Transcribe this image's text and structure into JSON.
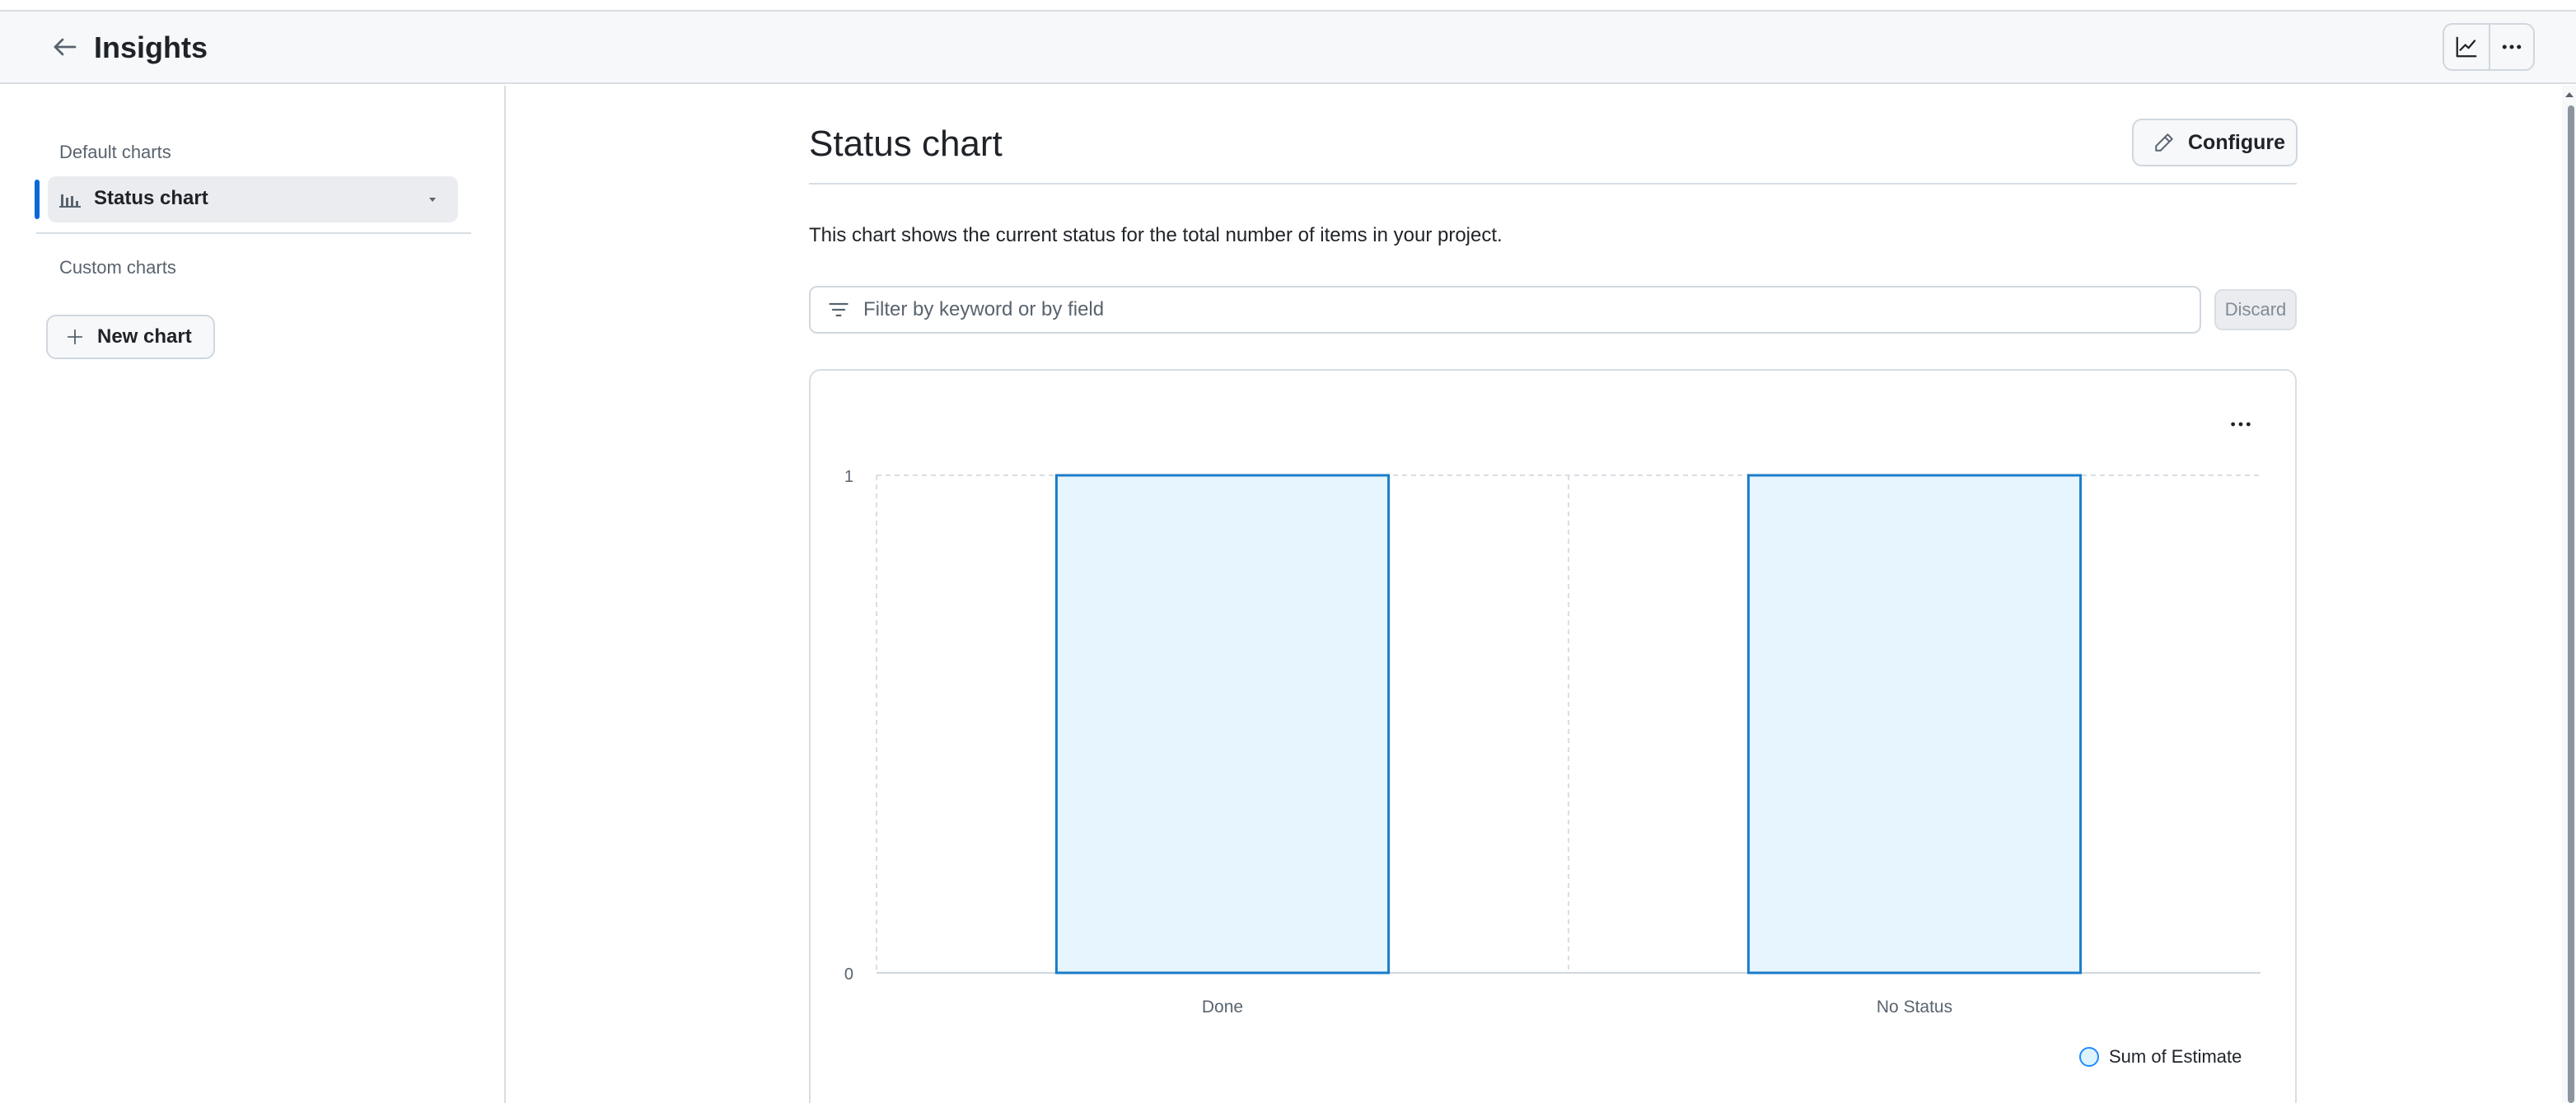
{
  "header": {
    "title": "Insights",
    "back_icon": "arrow-left-icon",
    "actions": [
      {
        "name": "insights-chart-icon"
      },
      {
        "name": "kebab-horizontal-icon"
      }
    ]
  },
  "sidebar": {
    "default_heading": "Default charts",
    "default_items": [
      {
        "label": "Status chart",
        "icon": "bar-chart-icon",
        "selected": true
      }
    ],
    "custom_heading": "Custom charts",
    "new_chart_label": "New chart"
  },
  "main": {
    "title": "Status chart",
    "configure_label": "Configure",
    "description": "This chart shows the current status for the total number of items in your project.",
    "filter": {
      "placeholder": "Filter by keyword or by field",
      "value": ""
    },
    "discard_label": "Discard"
  },
  "colors": {
    "accent": "#0969da",
    "bar_fill": "#e6f5fe",
    "bar_stroke": "#1b7cc8"
  },
  "chart_data": {
    "type": "bar",
    "categories": [
      "Done",
      "No Status"
    ],
    "series": [
      {
        "name": "Sum of Estimate",
        "values": [
          1,
          1
        ]
      }
    ],
    "y_ticks": [
      "1",
      "0"
    ],
    "ylim": [
      0,
      1
    ],
    "grid": true,
    "legend_position": "bottom-right",
    "title": "",
    "xlabel": "",
    "ylabel": ""
  }
}
